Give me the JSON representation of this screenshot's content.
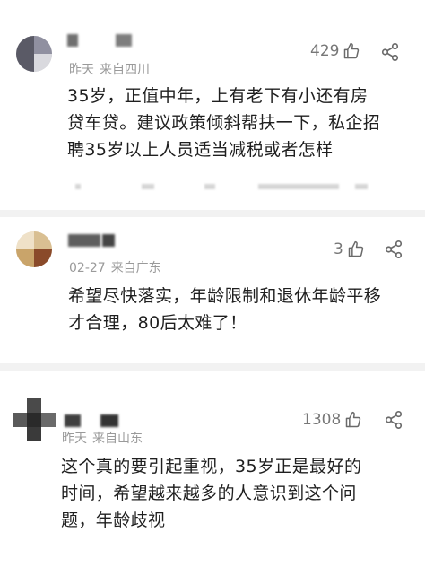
{
  "comments": [
    {
      "likes": "429",
      "date": "昨天",
      "location": "来自四川",
      "lines": [
        "35岁，正值中年，上有老下有小还有房",
        "贷车贷。建议政策倾斜帮扶一下，私企招",
        "聘35岁以上人员适当减税或者怎样"
      ]
    },
    {
      "likes": "3",
      "date": "02-27",
      "location": "来自广东",
      "lines": [
        "希望尽快落实，年龄限制和退休年龄平移",
        "才合理，80后太难了！"
      ]
    },
    {
      "likes": "1308",
      "date": "昨天",
      "location": "来自山东",
      "lines": [
        "这个真的要引起重视，35岁正是最好的",
        "时间，希望越来越多的人意识到这个问",
        "题，年龄歧视"
      ]
    }
  ]
}
